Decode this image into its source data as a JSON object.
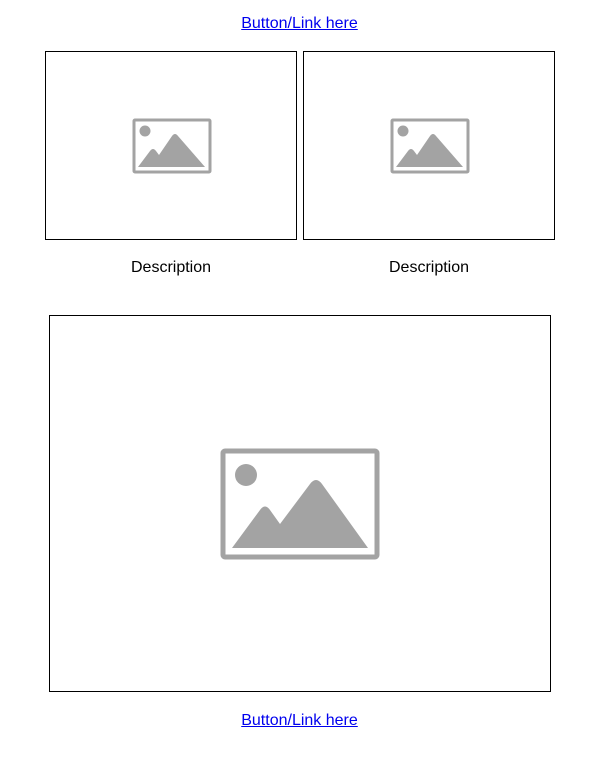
{
  "top_link": {
    "label": "Button/Link here"
  },
  "cards": [
    {
      "description": "Description",
      "image_icon": "image-placeholder-icon"
    },
    {
      "description": "Description",
      "image_icon": "image-placeholder-icon"
    }
  ],
  "feature_image": {
    "image_icon": "image-placeholder-icon"
  },
  "bottom_link": {
    "label": "Button/Link here"
  },
  "colors": {
    "link": "#0000ee",
    "frame_border": "#000000",
    "placeholder_gray": "#a3a3a3",
    "text": "#000000",
    "background": "#ffffff"
  }
}
